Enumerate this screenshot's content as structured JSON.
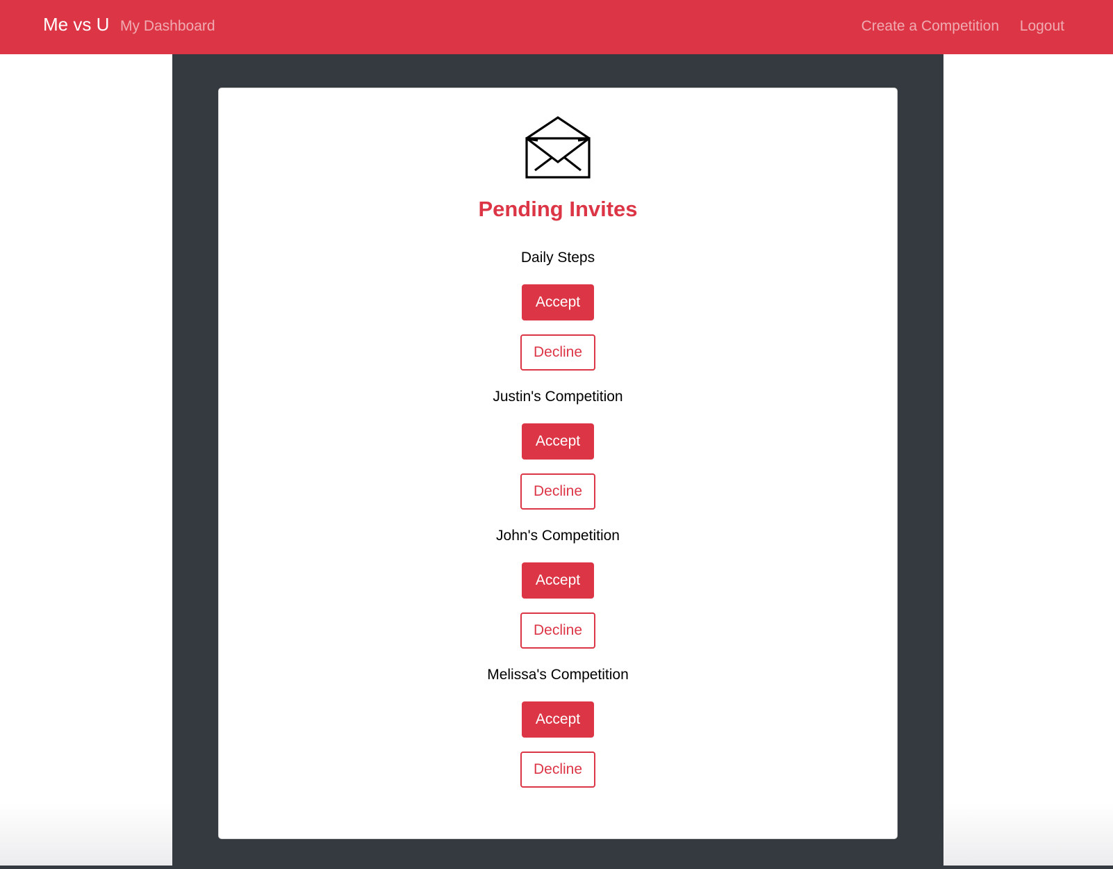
{
  "nav": {
    "brand": "Me vs U",
    "dashboard": "My Dashboard",
    "create": "Create a Competition",
    "logout": "Logout"
  },
  "colors": {
    "accent": "#dc3545",
    "panel": "#343a40",
    "card": "#ffffff"
  },
  "card": {
    "icon": "envelope-open-icon",
    "title": "Pending Invites"
  },
  "invites": [
    {
      "name": "Daily Steps",
      "accept": "Accept",
      "decline": "Decline"
    },
    {
      "name": "Justin's Competition",
      "accept": "Accept",
      "decline": "Decline"
    },
    {
      "name": "John's Competition",
      "accept": "Accept",
      "decline": "Decline"
    },
    {
      "name": "Melissa's Competition",
      "accept": "Accept",
      "decline": "Decline"
    }
  ]
}
